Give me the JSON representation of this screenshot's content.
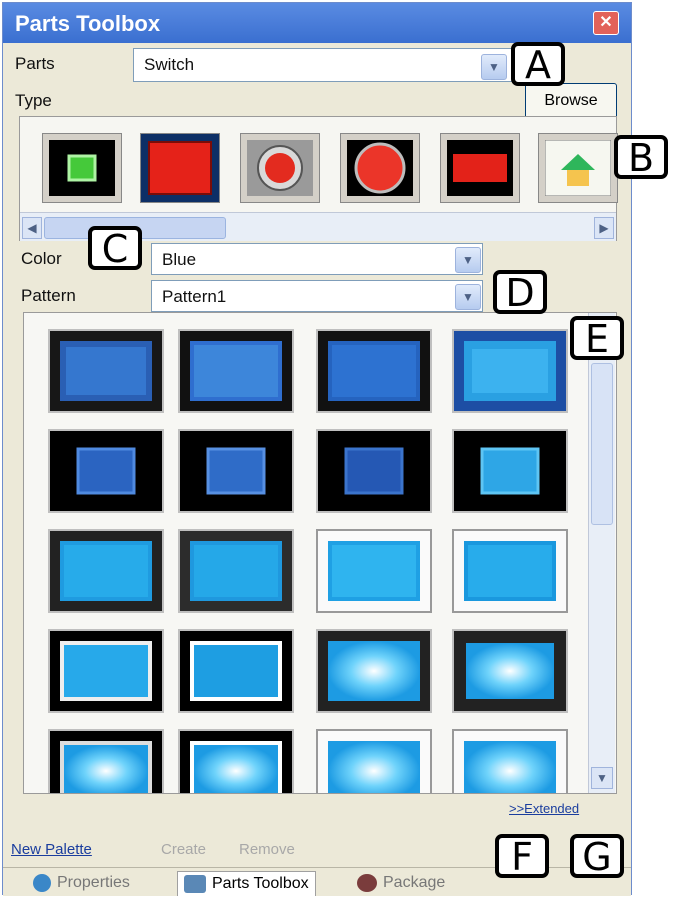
{
  "window": {
    "title": "Parts Toolbox",
    "close_glyph": "✕"
  },
  "parts": {
    "label": "Parts",
    "value": "Switch"
  },
  "type": {
    "label": "Type"
  },
  "browse": {
    "label": "Browse"
  },
  "type_items": [
    {
      "icon": "green-square-lamp-icon"
    },
    {
      "icon": "red-square-switch-icon"
    },
    {
      "icon": "red-round-switch-icon"
    },
    {
      "icon": "red-round-lamp-icon"
    },
    {
      "icon": "red-rect-switch-icon"
    },
    {
      "icon": "house-icon"
    }
  ],
  "color": {
    "label": "Color",
    "value": "Blue"
  },
  "pattern": {
    "label": "Pattern",
    "value": "Pattern1"
  },
  "extended": {
    "label": ">>Extended"
  },
  "actions": {
    "new_palette": "New Palette",
    "create": "Create",
    "remove": "Remove"
  },
  "tabs": [
    {
      "label": "Properties",
      "icon": "properties-icon",
      "active": false
    },
    {
      "label": "Parts Toolbox",
      "icon": "parts-toolbox-icon",
      "active": true
    },
    {
      "label": "Package",
      "icon": "package-icon",
      "active": false
    }
  ],
  "callouts": [
    "A",
    "B",
    "C",
    "D",
    "E",
    "F",
    "G"
  ],
  "colors": {
    "accent": "#3a6fd0",
    "blue_switch": "#2f79cf",
    "cyan_switch": "#23a6e3"
  }
}
